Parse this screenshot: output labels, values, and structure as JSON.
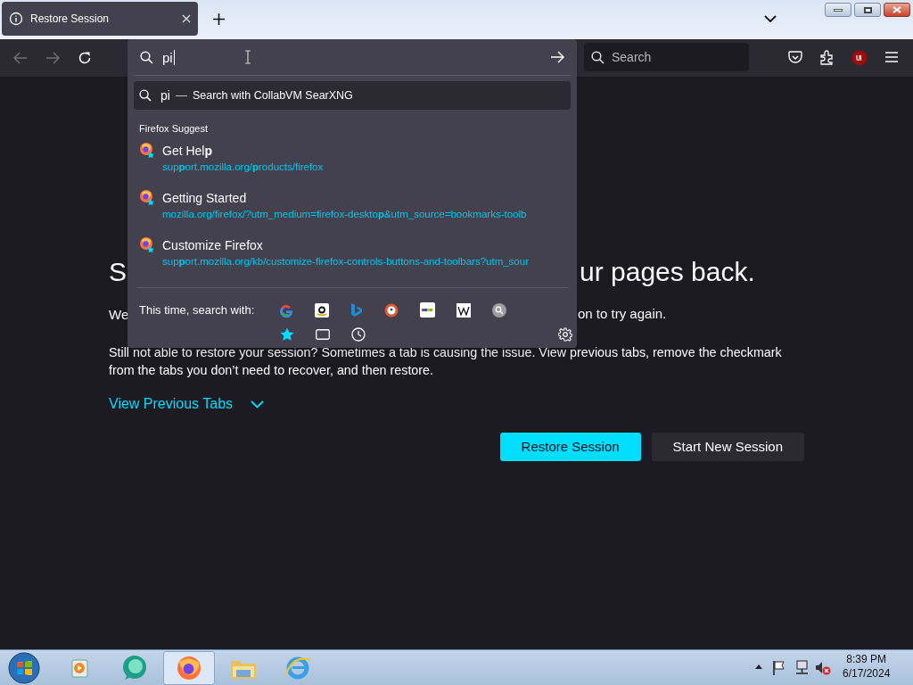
{
  "tab": {
    "title": "Restore Session",
    "selected": true
  },
  "urlbar": {
    "value": "pi"
  },
  "search_field": {
    "placeholder": "Search"
  },
  "popup": {
    "heading_row": {
      "query": "pi",
      "separator": "—",
      "action": "Search with CollabVM SearXNG",
      "selected": true
    },
    "group_label": "Firefox Suggest",
    "results": [
      {
        "title": "Get Hel**p**",
        "url": "sup**p**ort.mozilla.org/**p**roducts/firefox"
      },
      {
        "title": "Getting Started",
        "url": "mozilla.org/firefox/?utm_medium=firefox-deskto**p**&utm_source=bookmarks-toolb"
      },
      {
        "title": "Customize Firefox",
        "url": "sup**p**ort.mozilla.org/kb/customize-firefox-controls-buttons-and-toolbars?utm_sour"
      }
    ],
    "one_off_label": "This time, search with:"
  },
  "page": {
    "heading_parts": [
      "S",
      "ur pages back."
    ],
    "paragraph_1_parts": [
      "We",
      "on to try again."
    ],
    "paragraph_2": "Still not able to restore your session? Sometimes a tab is causing the issue. View previous tabs, remove the checkmark from the tabs you don’t need to recover, and then restore.",
    "link": "View Previous Tabs",
    "buttons": [
      {
        "label": "Restore Session",
        "kind": "primary"
      },
      {
        "label": "Start New Session",
        "kind": "secondary"
      }
    ]
  },
  "taskbar": {
    "apps": [
      {
        "selected": false
      },
      {
        "selected": false
      },
      {
        "selected": true
      },
      {
        "selected": false
      },
      {
        "selected": false
      }
    ],
    "time": "8:39 PM",
    "date": "6/17/2024"
  }
}
